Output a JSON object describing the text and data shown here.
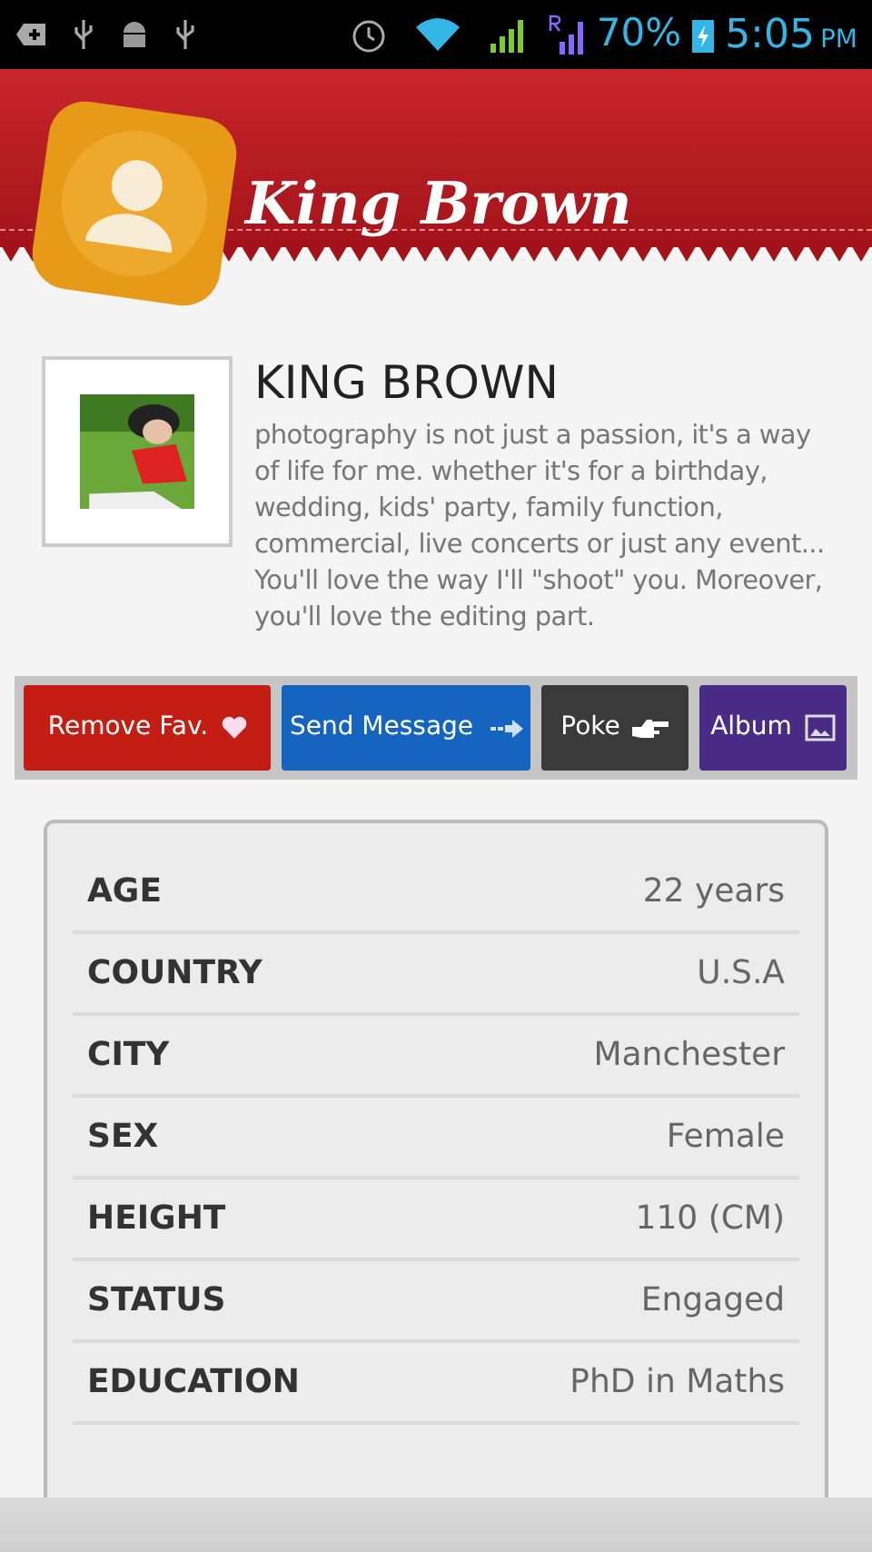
{
  "status_bar": {
    "battery": "70%",
    "time": "5:05",
    "ampm": "PM"
  },
  "header": {
    "title": "King Brown"
  },
  "profile": {
    "name": "KING BROWN",
    "bio": "photography is not just a passion, it's a way of life for me. whether it's for a birthday, wedding, kids' party, family function, commercial, live concerts or just any event... You'll love the way I'll \"shoot\" you. Moreover, you'll love the editing part."
  },
  "actions": [
    {
      "label": "Remove Fav.",
      "kind": "favorite"
    },
    {
      "label": "Send Message",
      "kind": "message"
    },
    {
      "label": "Poke",
      "kind": "poke"
    },
    {
      "label": "Album",
      "kind": "album"
    }
  ],
  "details": [
    {
      "label": "AGE",
      "value": "22 years"
    },
    {
      "label": "COUNTRY",
      "value": "U.S.A"
    },
    {
      "label": "CITY",
      "value": "Manchester"
    },
    {
      "label": "SEX",
      "value": "Female"
    },
    {
      "label": "HEIGHT",
      "value": "110 (CM)"
    },
    {
      "label": "STATUS",
      "value": "Engaged"
    },
    {
      "label": "EDUCATION",
      "value": "PhD in Maths"
    }
  ]
}
